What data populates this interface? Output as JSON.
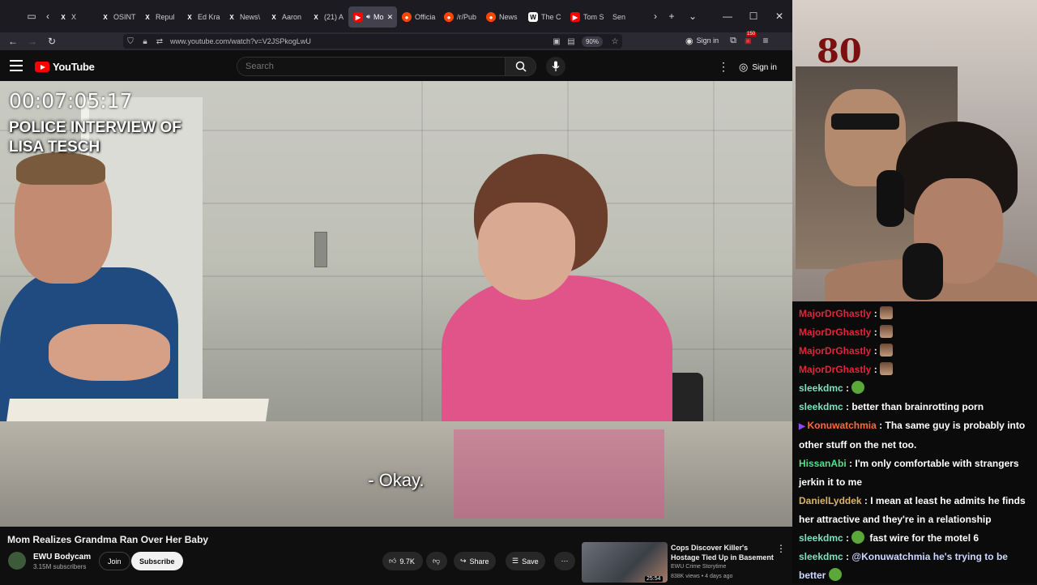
{
  "browser": {
    "tabs": [
      {
        "icon": "x-icon",
        "label": "X",
        "active": false
      },
      {
        "icon": "x-icon",
        "label": "OSINT",
        "active": false
      },
      {
        "icon": "x-icon",
        "label": "Repul",
        "active": false
      },
      {
        "icon": "x-icon",
        "label": "Ed Kra",
        "active": false
      },
      {
        "icon": "x-icon",
        "label": "News\\",
        "active": false
      },
      {
        "icon": "x-icon",
        "label": "Aaron",
        "active": false
      },
      {
        "icon": "x-icon",
        "label": "(21) A",
        "active": false
      },
      {
        "icon": "youtube-icon",
        "label": "Mo",
        "active": true
      },
      {
        "icon": "reddit-icon",
        "label": "Officia",
        "active": false
      },
      {
        "icon": "reddit-icon",
        "label": "/r/Pub",
        "active": false
      },
      {
        "icon": "reddit-icon",
        "label": "News",
        "active": false
      },
      {
        "icon": "wikipedia-icon",
        "label": "The C",
        "active": false
      },
      {
        "icon": "youtube-icon",
        "label": "Tom S",
        "active": false
      },
      {
        "icon": "",
        "label": "Sen",
        "active": false
      }
    ],
    "url": "www.youtube.com/watch?v=V2JSPkogLwU",
    "zoom": "90%",
    "signin_label": "Sign in",
    "badge": "150"
  },
  "youtube": {
    "logo_text": "YouTube",
    "search_placeholder": "Search",
    "signin_label": "Sign in"
  },
  "video": {
    "timecode": "00:07:05:17",
    "overlay_title_line1": "POLICE INTERVIEW OF",
    "overlay_title_line2": "LISA TESCH",
    "subtitle": "- Okay."
  },
  "below": {
    "title": "Mom Realizes Grandma Ran Over Her Baby",
    "channel": "EWU Bodycam",
    "subscribers": "3.15M subscribers",
    "join_label": "Join",
    "subscribe_label": "Subscribe",
    "likes": "9.7K",
    "share_label": "Share",
    "save_label": "Save"
  },
  "recommendation": {
    "title": "Cops Discover Killer's Hostage Tied Up in Basement",
    "channel": "EWU Crime Storytime",
    "meta": "838K views • 4 days ago",
    "duration": "25:54"
  },
  "colors": {
    "accent_red": "#ff0000",
    "chat_user_red": "#e0263a",
    "chat_user_teal": "#7ee0c2",
    "chat_user_orange": "#ff6a3d",
    "chat_user_green": "#4fe08a",
    "chat_user_gold": "#d8b46a",
    "chat_user_blue": "#79b6ff"
  },
  "chat": [
    {
      "user": "MajorDrGhastly",
      "sep": " : ",
      "text": "",
      "emote": "face-emote",
      "color": "#e0263a"
    },
    {
      "user": "MajorDrGhastly",
      "sep": " : ",
      "text": "",
      "emote": "face-emote",
      "color": "#e0263a"
    },
    {
      "user": "MajorDrGhastly",
      "sep": " : ",
      "text": "",
      "emote": "face-emote",
      "color": "#e0263a"
    },
    {
      "user": "MajorDrGhastly",
      "sep": " : ",
      "text": "",
      "emote": "face-emote",
      "color": "#e0263a"
    },
    {
      "user": "sleekdmc",
      "sep": " : ",
      "text": "",
      "emote": "frog-emote",
      "color": "#7ee0c2"
    },
    {
      "user": "sleekdmc",
      "sep": " : ",
      "text": "better than brainrotting porn",
      "emote": "",
      "color": "#7ee0c2"
    },
    {
      "user": "Konuwatchmia",
      "sep": " : ",
      "text": "Tha same guy is probably into other stuff on the net too.",
      "emote": "",
      "color": "#ff6a3d"
    },
    {
      "user": "HissanAbi",
      "sep": " : ",
      "text": "I'm only comfortable with strangers jerkin it to me",
      "emote": "",
      "color": "#4fe08a"
    },
    {
      "user": "DanielLyddek",
      "sep": " : ",
      "text": "I mean at least he admits he finds her attractive and they're in a relationship",
      "emote": "",
      "color": "#d8b46a"
    },
    {
      "user": "sleekdmc",
      "sep": " : ",
      "text": "fast wire for the motel 6",
      "emote": "frog-emote",
      "color": "#7ee0c2"
    },
    {
      "user": "sleekdmc",
      "sep": " : ",
      "text": "@Konuwatchmia he's trying to be better",
      "emote": "frog-emote",
      "color": "#7ee0c2"
    }
  ]
}
